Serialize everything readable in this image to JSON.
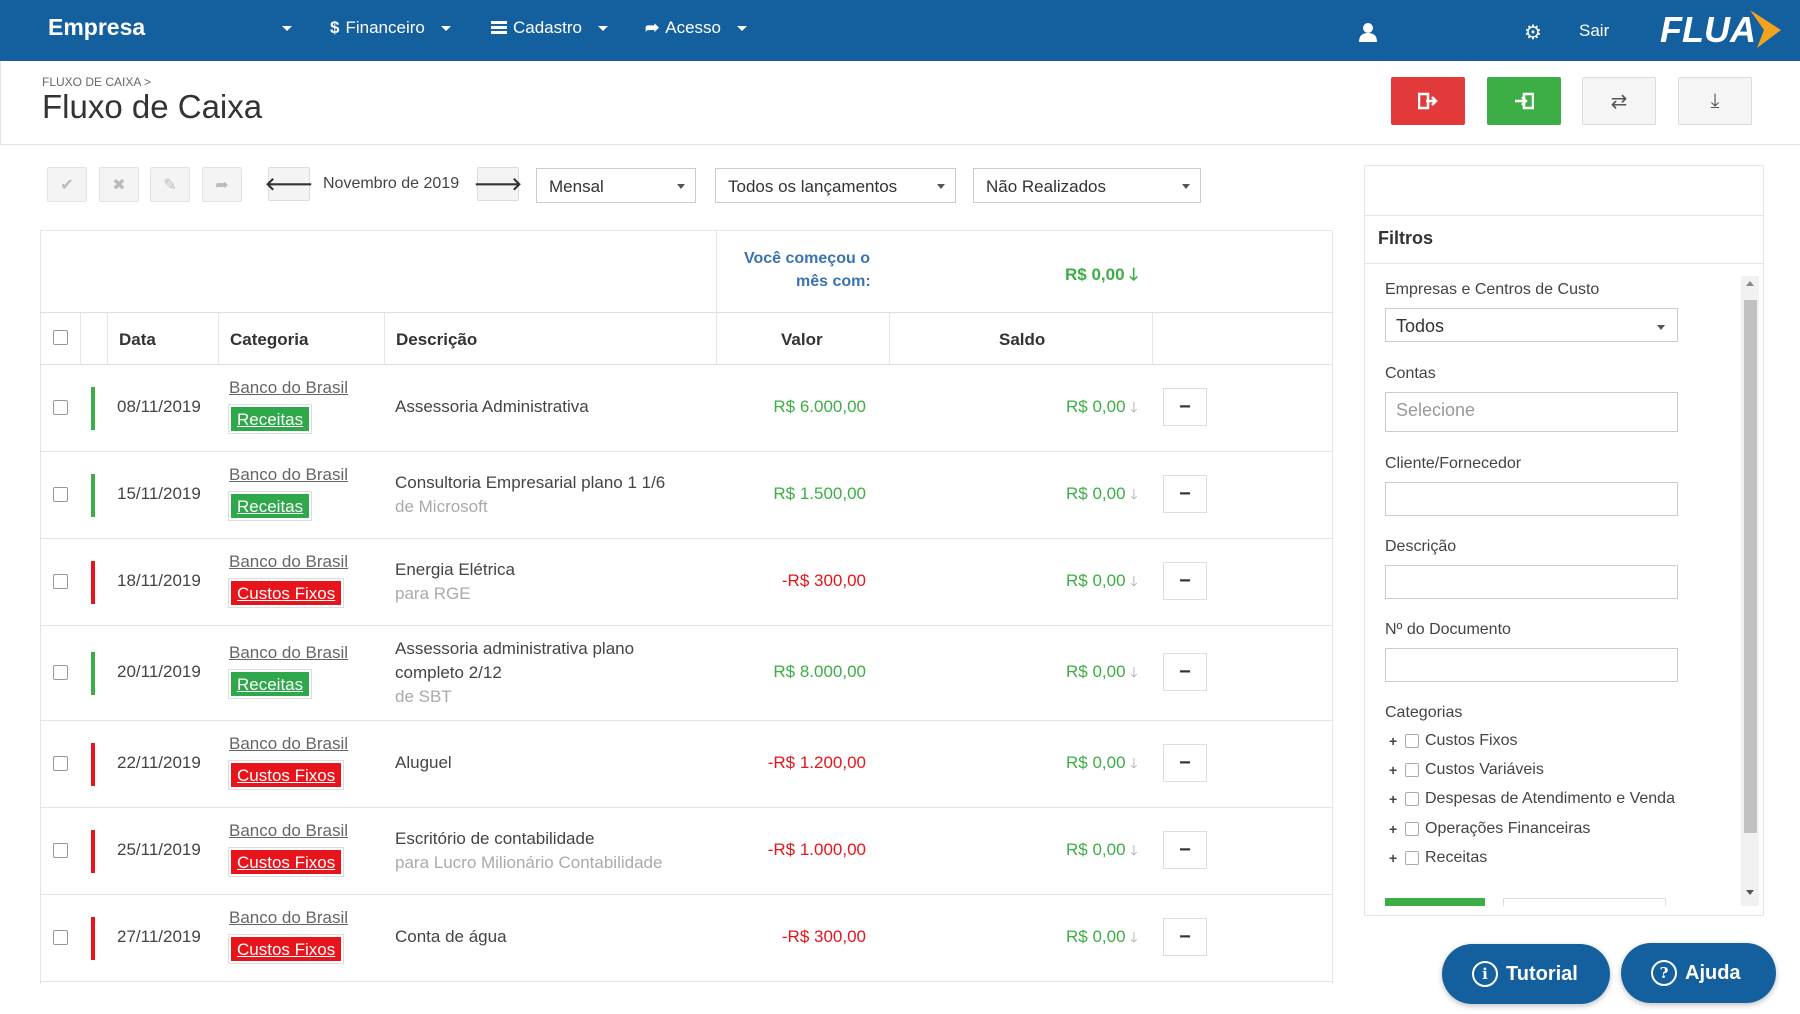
{
  "nav": {
    "brand": "Empresa",
    "financeiro": "Financeiro",
    "cadastro": "Cadastro",
    "acesso": "Acesso",
    "sair": "Sair",
    "logo": "FLUA"
  },
  "header": {
    "breadcrumb": "FLUXO DE CAIXA >",
    "title": "Fluxo de Caixa"
  },
  "toolbar": {
    "month": "Novembro de 2019",
    "period": "Mensal",
    "type": "Todos os lançamentos",
    "status": "Não Realizados"
  },
  "summary": {
    "start_line1": "Você começou o",
    "start_line2": "mês com:",
    "start_value": "R$ 0,00 🡓"
  },
  "columns": {
    "data": "Data",
    "categoria": "Categoria",
    "descricao": "Descrição",
    "valor": "Valor",
    "saldo": "Saldo"
  },
  "rows": [
    {
      "date": "08/11/2019",
      "bank": "Banco do Brasil",
      "category": "Receitas",
      "desc": "Assessoria Administrativa",
      "desc2": "",
      "sub": "",
      "value": "R$ 6.000,00",
      "saldo": "R$ 0,00",
      "arrow": "🡓"
    },
    {
      "date": "15/11/2019",
      "bank": "Banco do Brasil",
      "category": "Receitas",
      "desc": "Consultoria Empresarial plano 1 1/6",
      "desc2": "",
      "sub": "de Microsoft",
      "value": "R$ 1.500,00",
      "saldo": "R$ 0,00",
      "arrow": "🡓"
    },
    {
      "date": "18/11/2019",
      "bank": "Banco do Brasil",
      "category": "Custos Fixos",
      "desc": "Energia Elétrica",
      "desc2": "",
      "sub": "para RGE",
      "value": "-R$ 300,00",
      "saldo": "R$ 0,00",
      "arrow": "🡓"
    },
    {
      "date": "20/11/2019",
      "bank": "Banco do Brasil",
      "category": "Receitas",
      "desc": "Assessoria administrativa plano",
      "desc2": "completo 2/12",
      "sub": "de SBT",
      "value": "R$ 8.000,00",
      "saldo": "R$ 0,00",
      "arrow": "🡓"
    },
    {
      "date": "22/11/2019",
      "bank": "Banco do Brasil",
      "category": "Custos Fixos",
      "desc": "Aluguel",
      "desc2": "",
      "sub": "",
      "value": "-R$ 1.200,00",
      "saldo": "R$ 0,00",
      "arrow": "🡓"
    },
    {
      "date": "25/11/2019",
      "bank": "Banco do Brasil",
      "category": "Custos Fixos",
      "desc": "Escritório de contabilidade",
      "desc2": "",
      "sub": "para Lucro Milionário Contabilidade",
      "value": "-R$ 1.000,00",
      "saldo": "R$ 0,00",
      "arrow": "🡓"
    },
    {
      "date": "27/11/2019",
      "bank": "Banco do Brasil",
      "category": "Custos Fixos",
      "desc": "Conta de água",
      "desc2": "",
      "sub": "",
      "value": "-R$ 300,00",
      "saldo": "R$ 0,00",
      "arrow": "🡓"
    }
  ],
  "filters": {
    "title": "Filtros",
    "empresas_label": "Empresas e Centros de Custo",
    "empresas_value": "Todos",
    "contas_label": "Contas",
    "contas_placeholder": "Selecione",
    "cliente_label": "Cliente/Fornecedor",
    "descricao_label": "Descrição",
    "documento_label": "Nº do Documento",
    "categorias_label": "Categorias",
    "categorias": [
      "Custos Fixos",
      "Custos Variáveis",
      "Despesas de Atendimento e Venda",
      "Operações Financeiras",
      "Receitas"
    ]
  },
  "help": {
    "tutorial": "Tutorial",
    "ajuda": "Ajuda"
  },
  "colors": {
    "nav_bg": "#14609e",
    "positive": "#3cae45",
    "negative": "#e8141b",
    "receitas_tag": "#2ea84a",
    "custos_tag": "#e8141b"
  }
}
